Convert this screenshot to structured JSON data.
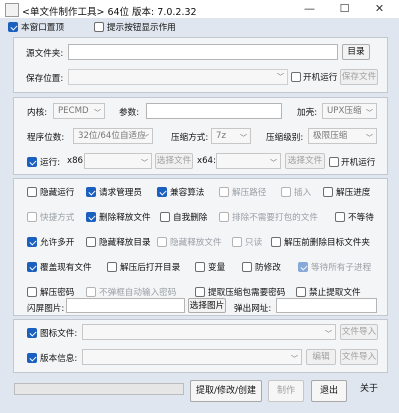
{
  "window": {
    "title": "<单文件制作工具> 64位 版本: 7.0.2.32",
    "min": "—",
    "max": "☐",
    "close": "✕"
  },
  "top": {
    "single_window": "本窗口置顶",
    "hint_tooltip": "提示按钮显示作用"
  },
  "source": {
    "label": "源文件夹:",
    "value": "",
    "button": "目录"
  },
  "save": {
    "label": "保存位置:",
    "autorun": "开机运行",
    "button": "保存文件"
  },
  "kernel": {
    "label": "内核:",
    "value": "PECMD",
    "params_label": "参数:",
    "params": "",
    "packer_label": "加壳:",
    "packer": "UPX压缩"
  },
  "program": {
    "label": "程序位数:",
    "value": "32位/64位自适应",
    "compress_label": "压缩方式:",
    "compress": "7z",
    "level_label": "压缩级别:",
    "level": "极限压缩"
  },
  "run": {
    "label": "运行:",
    "x86_label": "x86:",
    "x86_value": "",
    "x86_button": "选择文件",
    "x64_label": "x64:",
    "x64_value": "",
    "x64_button": "选择文件",
    "autorun": "开机运行"
  },
  "options": [
    [
      "隐藏运行",
      "请求管理员",
      "兼容算法",
      "解压路径",
      "插入",
      "解压进度"
    ],
    [
      "快捷方式",
      "删除释放文件",
      "自我删除",
      "排除不需要打包的文件",
      "不等待"
    ],
    [
      "允许多开",
      "隐藏释放目录",
      "隐藏释放文件",
      "只读",
      "解压前删除目标文件夹"
    ],
    [
      "覆盖现有文件",
      "解压后打开目录",
      "变量",
      "防修改",
      "等待所有子进程"
    ],
    [
      "解压密码",
      "不弹框自动输入密码",
      "提取压缩包需要密码",
      "禁止提取文件"
    ]
  ],
  "splash": {
    "label": "闪屏图片:",
    "value": "",
    "button": "选择图片",
    "popup_label": "弹出网址:",
    "popup_value": ""
  },
  "icon": {
    "label": "图标文件:",
    "value": "",
    "button": "文件导入"
  },
  "version": {
    "label": "版本信息:",
    "value": "",
    "edit": "编辑",
    "button": "文件导入"
  },
  "actions": {
    "extract": "提取/修改/创建",
    "make": "制作",
    "exit": "退出",
    "about": "关于"
  },
  "colors": {
    "accent": "#1b5fbf",
    "background": "#dfe6ef",
    "panel": "#f4f5f7"
  }
}
